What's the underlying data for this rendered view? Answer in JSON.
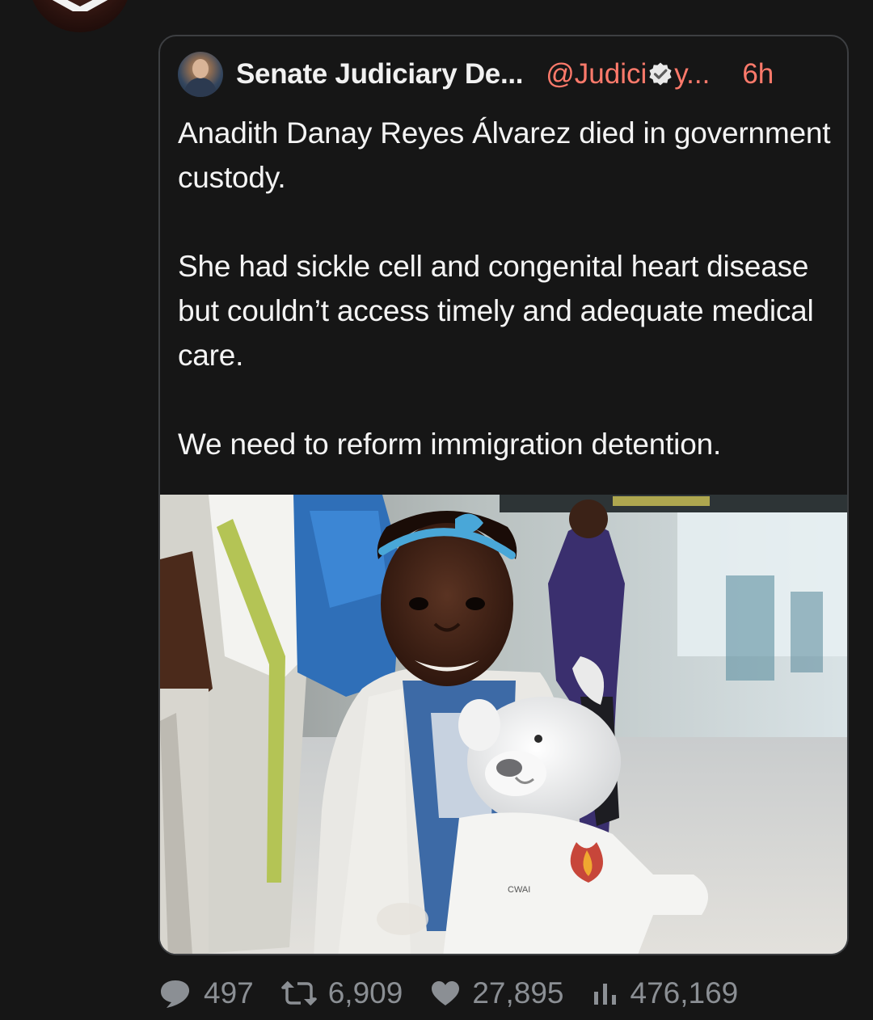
{
  "quoted_tweet": {
    "author_name": "Senate Judiciary De...",
    "handle_start": "@Judici",
    "handle_end": "y...",
    "time": "6h",
    "text": "Anadith Danay Reyes Álvarez died in government custody.\n\nShe had sickle cell and congenital heart disease but couldn’t access timely and adequate medical care.\n\nWe need to reform immigration detention.",
    "image_text": "CWAI"
  },
  "actions": {
    "replies": "497",
    "retweets": "6,909",
    "likes": "27,895",
    "views": "476,169"
  },
  "colors": {
    "background": "#161616",
    "accent": "#ff7a6b",
    "muted": "#8b8f94",
    "border": "#3d3f42"
  }
}
